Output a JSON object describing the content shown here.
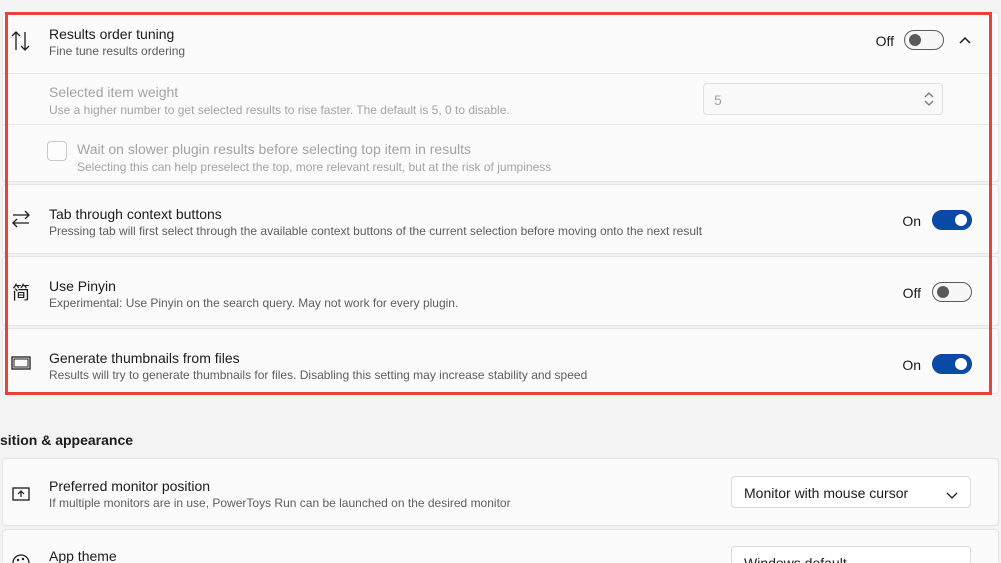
{
  "results_order": {
    "title": "Results order tuning",
    "description": "Fine tune results ordering",
    "state": "Off",
    "icon": "sort-arrows-icon",
    "selected_item_weight": {
      "title": "Selected item weight",
      "description": "Use a higher number to get selected results to rise faster. The default is 5, 0 to disable.",
      "value": "5"
    },
    "wait_slower_plugin": {
      "title": "Wait on slower plugin results before selecting top item in results",
      "description": "Selecting this can help preselect the top, more relevant result, but at the risk of jumpiness"
    }
  },
  "tab_context": {
    "title": "Tab through context buttons",
    "description": "Pressing tab will first select through the available context buttons of the current selection before moving onto the next result",
    "state": "On",
    "icon": "tab-arrows-icon"
  },
  "pinyin": {
    "title": "Use Pinyin",
    "description": "Experimental: Use Pinyin on the search query. May not work for every plugin.",
    "state": "Off",
    "icon_glyph": "简"
  },
  "thumbnails": {
    "title": "Generate thumbnails from files",
    "description": "Results will try to generate thumbnails for files. Disabling this setting may increase stability and speed",
    "state": "On",
    "icon": "thumbnail-icon"
  },
  "position_section": {
    "header": "sition & appearance"
  },
  "monitor_position": {
    "title": "Preferred monitor position",
    "description": "If multiple monitors are in use, PowerToys Run can be launched on the desired monitor",
    "value": "Monitor with mouse cursor",
    "icon": "monitor-icon"
  },
  "app_theme": {
    "title": "App theme",
    "value": "Windows default",
    "icon": "palette-icon"
  },
  "colors": {
    "accent": "#0a4aa6",
    "highlight": "#e8433b"
  }
}
